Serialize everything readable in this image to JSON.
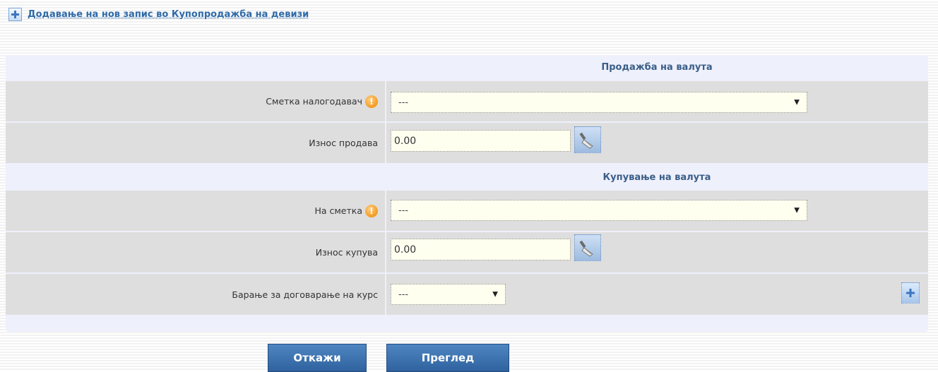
{
  "header": {
    "link_text": "Додавање на нов запис во Купопродажба на девизи"
  },
  "sections": {
    "sell_title": "Продажба на валута",
    "buy_title": "Купување на валута"
  },
  "fields": {
    "payer_account_label": "Сметка налогодавач",
    "payer_account_value": "---",
    "sell_amount_label": "Износ продава",
    "sell_amount_value": "0.00",
    "to_account_label": "На сметка",
    "to_account_value": "---",
    "buy_amount_label": "Износ купува",
    "buy_amount_value": "0.00",
    "rate_request_label": "Барање за договарање на курс",
    "rate_request_value": "---"
  },
  "buttons": {
    "cancel_label": "Откажи",
    "preview_label": "Преглед"
  },
  "icons": {
    "add": "plus-icon",
    "info": "info-icon",
    "clear": "broom-icon",
    "dropdown": "chevron-down-icon"
  },
  "colors": {
    "accent": "#2f629e",
    "link": "#2e6aa8",
    "warning": "#f29a1f",
    "field_bg": "#fffff0",
    "row_bg": "#dedede",
    "panel_bg": "#eef0fb"
  }
}
